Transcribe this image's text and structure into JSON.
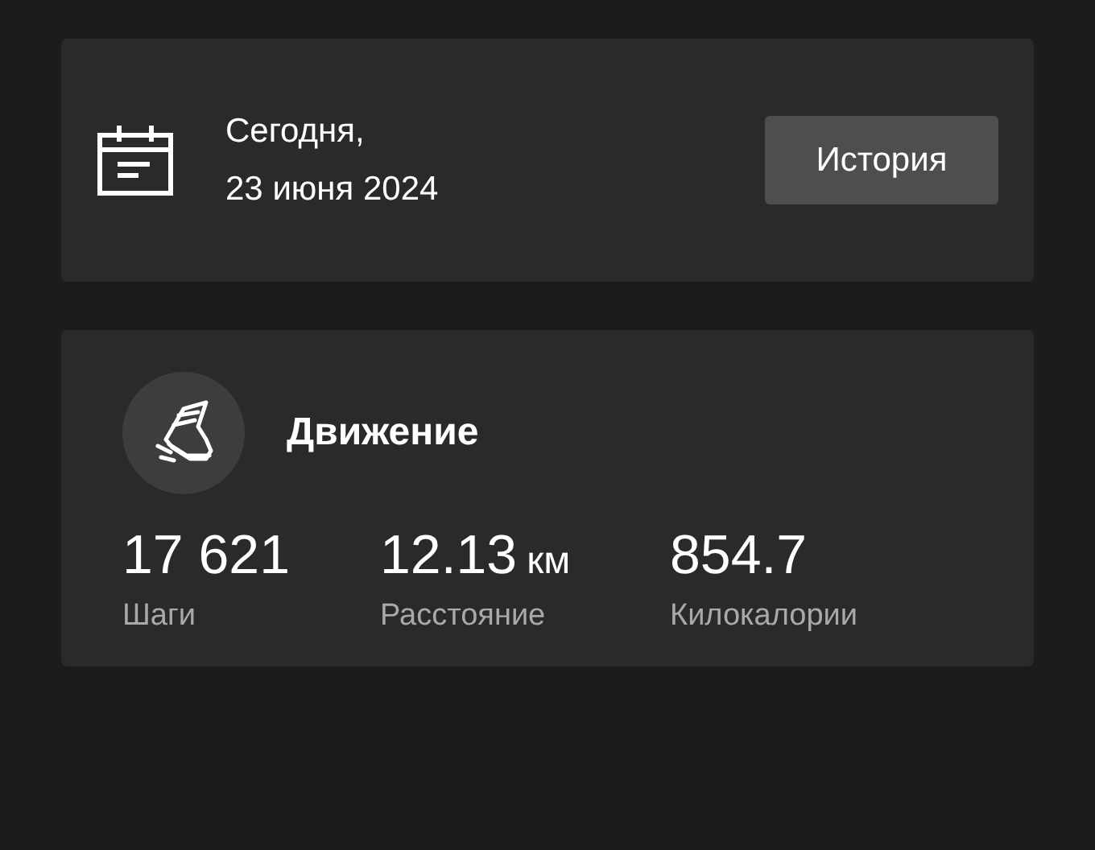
{
  "date_card": {
    "line_1": "Сегодня,",
    "line_2": "23 июня 2024",
    "button": "История"
  },
  "activity_card": {
    "title": "Движение",
    "stats": [
      {
        "value": "17 621",
        "label": "Шаги"
      },
      {
        "value": "12.13",
        "unit": "км",
        "label": "Расстояние"
      },
      {
        "value": "854.7",
        "label": "Килокалории"
      }
    ]
  }
}
